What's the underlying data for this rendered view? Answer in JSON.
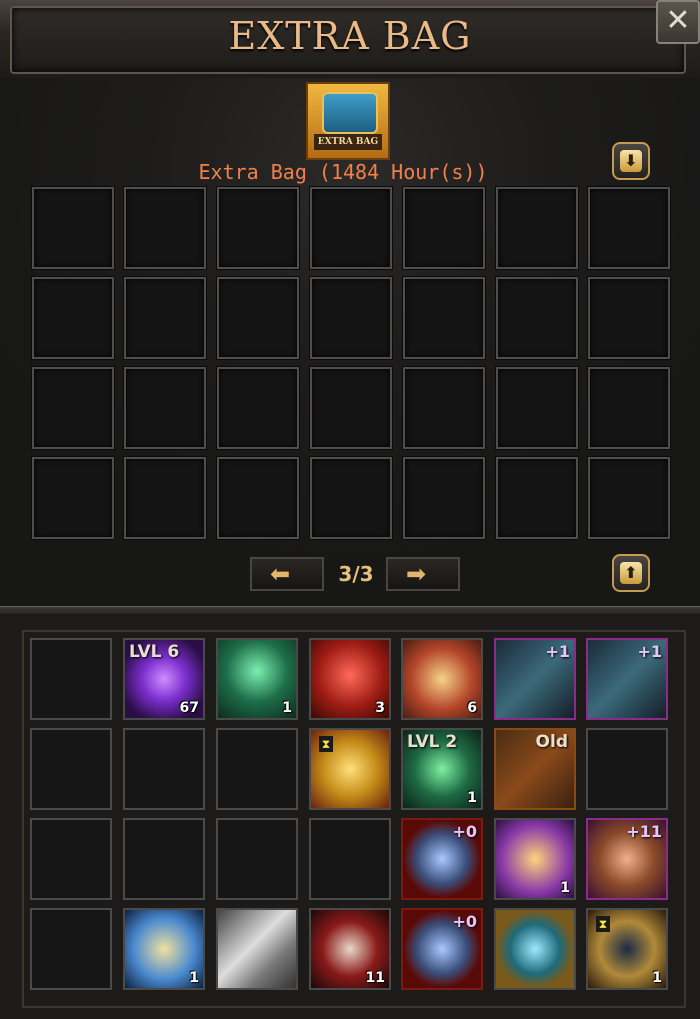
{
  "header": {
    "title": "EXTRA BAG",
    "close_glyph": "✕"
  },
  "bag": {
    "icon_label": "EXTRA BAG",
    "label": "Extra Bag (1484 Hour(s))",
    "sort_down_glyph": "⬇",
    "sort_up_glyph": "⬆"
  },
  "pager": {
    "prev_glyph": "⬅",
    "next_glyph": "➡",
    "page": "3/3"
  },
  "inventory": {
    "items": [
      {
        "name": "empty",
        "qty": "",
        "tag": "",
        "plus": ""
      },
      {
        "name": "purple-orb-icon",
        "qty": "67",
        "tag": "LVL 6",
        "plus": ""
      },
      {
        "name": "green-chest-icon",
        "qty": "1",
        "tag": "",
        "plus": ""
      },
      {
        "name": "red-chest-icon",
        "qty": "3",
        "tag": "",
        "plus": ""
      },
      {
        "name": "scroll-icon",
        "qty": "6",
        "tag": "",
        "plus": ""
      },
      {
        "name": "sword-icon",
        "qty": "",
        "tag": "",
        "plus": "+1"
      },
      {
        "name": "sword-icon",
        "qty": "",
        "tag": "",
        "plus": "+1"
      },
      {
        "name": "empty",
        "qty": "",
        "tag": "",
        "plus": ""
      },
      {
        "name": "empty",
        "qty": "",
        "tag": "",
        "plus": ""
      },
      {
        "name": "empty",
        "qty": "",
        "tag": "",
        "plus": ""
      },
      {
        "name": "golden-armor-icon",
        "qty": "",
        "tag": "",
        "plus": ""
      },
      {
        "name": "green-shard-icon",
        "qty": "1",
        "tag": "LVL 2",
        "plus": ""
      },
      {
        "name": "red-dagger-icon",
        "qty": "",
        "tag": "Old",
        "plus": ""
      },
      {
        "name": "empty",
        "qty": "",
        "tag": "",
        "plus": ""
      },
      {
        "name": "empty",
        "qty": "",
        "tag": "",
        "plus": ""
      },
      {
        "name": "empty",
        "qty": "",
        "tag": "",
        "plus": ""
      },
      {
        "name": "empty",
        "qty": "",
        "tag": "",
        "plus": ""
      },
      {
        "name": "empty",
        "qty": "",
        "tag": "",
        "plus": ""
      },
      {
        "name": "blue-ring-icon",
        "qty": "",
        "tag": "",
        "plus": "+0"
      },
      {
        "name": "golden-scroll-icon",
        "qty": "1",
        "tag": "",
        "plus": ""
      },
      {
        "name": "armor-chest-icon",
        "qty": "",
        "tag": "",
        "plus": "+11"
      },
      {
        "name": "empty",
        "qty": "",
        "tag": "",
        "plus": ""
      },
      {
        "name": "ncs-scroll-icon",
        "qty": "1",
        "tag": "",
        "plus": ""
      },
      {
        "name": "silver-bar-icon",
        "qty": "",
        "tag": "",
        "plus": ""
      },
      {
        "name": "red-scroll-icon",
        "qty": "11",
        "tag": "",
        "plus": ""
      },
      {
        "name": "blue-ring-icon",
        "qty": "",
        "tag": "",
        "plus": "+0"
      },
      {
        "name": "blue-medallion-icon",
        "qty": "",
        "tag": "",
        "plus": ""
      },
      {
        "name": "magnifier-icon",
        "qty": "1",
        "tag": "",
        "plus": ""
      }
    ]
  },
  "colors": {
    "title": "#e9b987",
    "bag_label": "#f0814b",
    "page_num": "#e7c07a"
  }
}
